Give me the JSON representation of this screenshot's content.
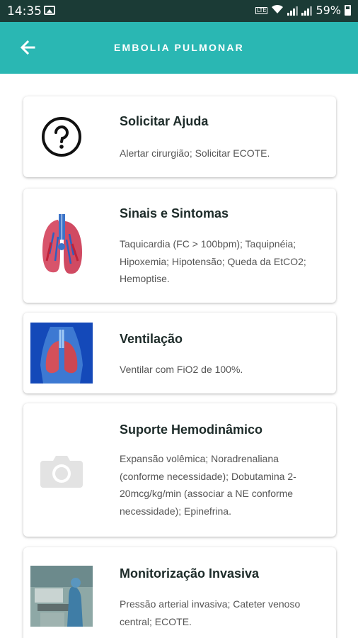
{
  "status_bar": {
    "time": "14:35",
    "battery": "59%",
    "lte": "LTE"
  },
  "app_bar": {
    "title": "EMBOLIA PULMONAR",
    "back_icon": "arrow-left-icon"
  },
  "colors": {
    "status_bar": "#1b3b36",
    "app_bar": "#2ab7b3",
    "card_title": "#1d2b29",
    "card_text": "#555555"
  },
  "cards": [
    {
      "title": "Solicitar Ajuda",
      "description": "Alertar cirurgião; Solicitar ECOTE.",
      "icon": "help-circle-icon"
    },
    {
      "title": "Sinais e Sintomas",
      "description": "Taquicardia (FC > 100bpm); Taquipnéia; Hipoxemia; Hipotensão; Queda da EtCO2; Hemoptise.",
      "icon": "lungs-illustration"
    },
    {
      "title": "Ventilação",
      "description": "Ventilar com FiO2 de 100%.",
      "icon": "chest-xray-image"
    },
    {
      "title": "Suporte Hemodinâmico",
      "description": "Expansão volêmica; Noradrenaliana (conforme necessidade); Dobutamina 2-20mcg/kg/min (associar a NE conforme necessidade); Epinefrina.",
      "icon": "camera-placeholder-icon"
    },
    {
      "title": "Monitorização Invasiva",
      "description": "Pressão arterial invasiva; Cateter venoso central; ECOTE.",
      "icon": "operating-room-image"
    }
  ]
}
